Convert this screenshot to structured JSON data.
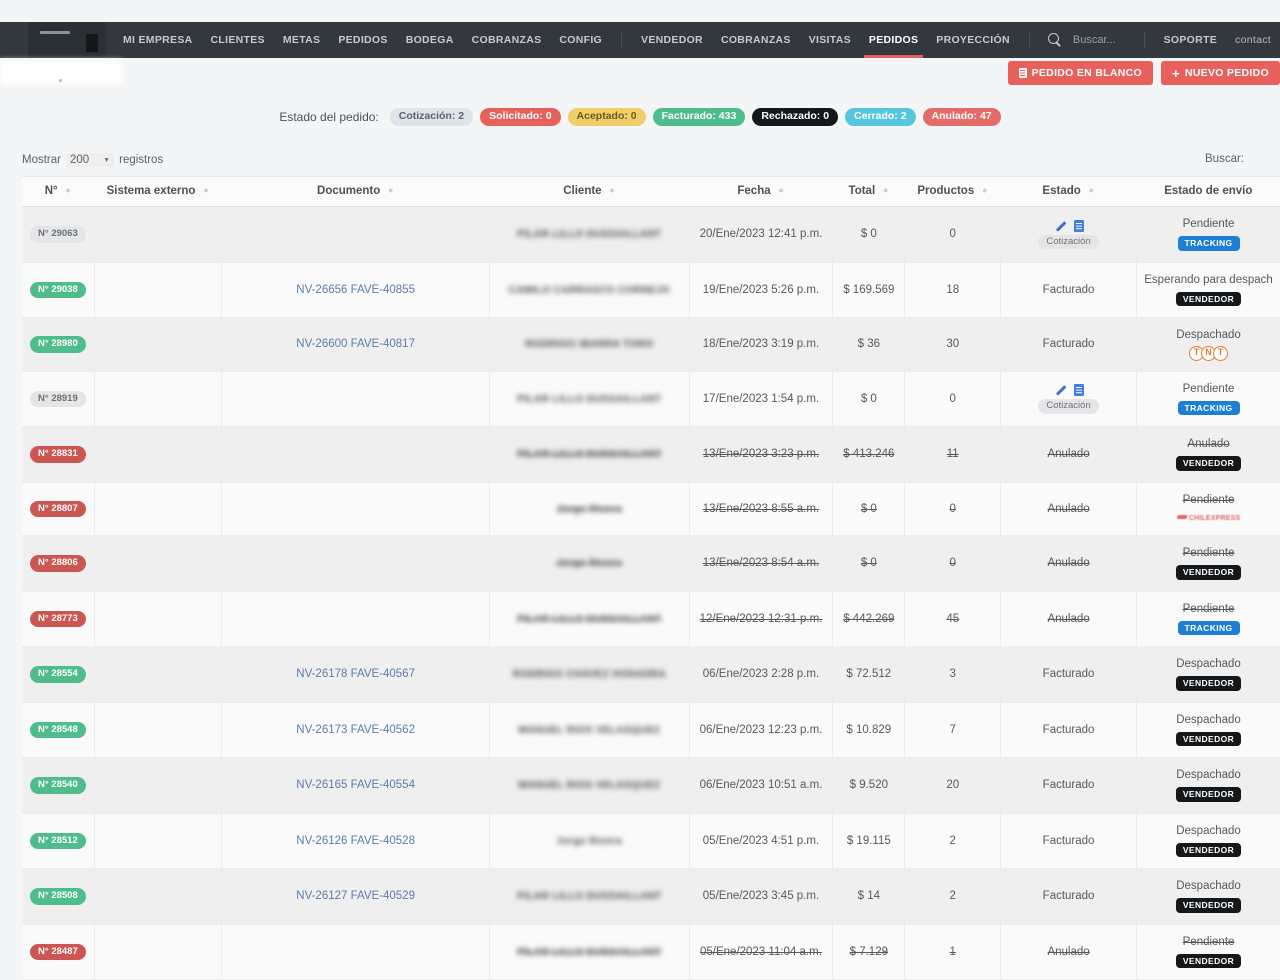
{
  "nav": {
    "primary": [
      {
        "label": "MI EMPRESA"
      },
      {
        "label": "CLIENTES"
      },
      {
        "label": "METAS"
      },
      {
        "label": "PEDIDOS"
      },
      {
        "label": "BODEGA"
      },
      {
        "label": "COBRANZAS"
      },
      {
        "label": "CONFIG"
      }
    ],
    "secondary": [
      {
        "label": "VENDEDOR",
        "active": false
      },
      {
        "label": "COBRANZAS",
        "active": false
      },
      {
        "label": "VISITAS",
        "active": false
      },
      {
        "label": "PEDIDOS",
        "active": true
      },
      {
        "label": "PROYECCIÓN",
        "active": false
      }
    ],
    "search_placeholder": "Buscar...",
    "right": [
      {
        "label": "SOPORTE"
      },
      {
        "label": "contact"
      }
    ]
  },
  "actions": {
    "blank_order": "PEDIDO EN BLANCO",
    "new_order": "NUEVO PEDIDO"
  },
  "status": {
    "label": "Estado del pedido:",
    "pills": [
      {
        "label": "Cotización: 2",
        "bg": "#dfe3ea",
        "fg": "#5b6472"
      },
      {
        "label": "Solicitado: 0",
        "bg": "#e8605c",
        "fg": "#ffffff"
      },
      {
        "label": "Aceptado: 0",
        "bg": "#f0ce6a",
        "fg": "#6d5a1c"
      },
      {
        "label": "Facturado: 433",
        "bg": "#4fbd8b",
        "fg": "#ffffff"
      },
      {
        "label": "Rechazado: 0",
        "bg": "#15181b",
        "fg": "#ffffff"
      },
      {
        "label": "Cerrado: 2",
        "bg": "#55c6de",
        "fg": "#ffffff"
      },
      {
        "label": "Anulado: 47",
        "bg": "#e46b67",
        "fg": "#ffffff"
      }
    ]
  },
  "table_controls": {
    "show_prefix": "Mostrar",
    "show_value": "200",
    "show_suffix": "registros",
    "search_label": "Buscar:"
  },
  "table": {
    "columns": [
      {
        "label": "N°",
        "sortable": true
      },
      {
        "label": "Sistema externo",
        "sortable": true
      },
      {
        "label": "Documento",
        "sortable": true
      },
      {
        "label": "Cliente",
        "sortable": true
      },
      {
        "label": "Fecha",
        "sortable": true
      },
      {
        "label": "Total",
        "sortable": true
      },
      {
        "label": "Productos",
        "sortable": true
      },
      {
        "label": "Estado",
        "sortable": true
      },
      {
        "label": "Estado de envío",
        "sortable": false
      }
    ],
    "rows": [
      {
        "num": "N° 29063",
        "num_style": "gray",
        "sistema_externo": "",
        "documento": "",
        "cliente": "PILAR LILLO DUSSAILLANT",
        "fecha": "20/Ene/2023 12:41 p.m.",
        "total": "$ 0",
        "productos": "0",
        "estado": "",
        "estado_icons": true,
        "estado_badge": "Cotización",
        "envio": "Pendiente",
        "envio_tag": "TRACKING",
        "envio_tag_type": "tracking",
        "struck": false
      },
      {
        "num": "N° 29038",
        "num_style": "green",
        "sistema_externo": "",
        "documento": "NV-26656 FAVE-40855",
        "cliente": "CAMILO CARRASCO CORNEJO",
        "fecha": "19/Ene/2023 5:26 p.m.",
        "total": "$ 169.569",
        "productos": "18",
        "estado": "Facturado",
        "estado_icons": false,
        "estado_badge": "",
        "envio": "Esperando para despach",
        "envio_tag": "VENDEDOR",
        "envio_tag_type": "vendedor",
        "struck": false
      },
      {
        "num": "N° 28980",
        "num_style": "green",
        "sistema_externo": "",
        "documento": "NV-26600 FAVE-40817",
        "cliente": "RODRIGO IBARRA TORO",
        "fecha": "18/Ene/2023 3:19 p.m.",
        "total": "$ 36",
        "productos": "30",
        "estado": "Facturado",
        "estado_icons": false,
        "estado_badge": "",
        "envio": "Despachado",
        "envio_tag": "TNT",
        "envio_tag_type": "tnt",
        "struck": false
      },
      {
        "num": "N° 28919",
        "num_style": "gray",
        "sistema_externo": "",
        "documento": "",
        "cliente": "PILAR LILLO DUSSAILLANT",
        "fecha": "17/Ene/2023 1:54 p.m.",
        "total": "$ 0",
        "productos": "0",
        "estado": "",
        "estado_icons": true,
        "estado_badge": "Cotización",
        "envio": "Pendiente",
        "envio_tag": "TRACKING",
        "envio_tag_type": "tracking",
        "struck": false
      },
      {
        "num": "N° 28831",
        "num_style": "red",
        "sistema_externo": "",
        "documento": "",
        "cliente": "PILAR LILLO DUSSAILLANT",
        "fecha": "13/Ene/2023 3:23 p.m.",
        "total": "$ 413.246",
        "productos": "11",
        "estado": "Anulado",
        "estado_icons": false,
        "estado_badge": "",
        "envio": "Anulado",
        "envio_tag": "VENDEDOR",
        "envio_tag_type": "vendedor",
        "struck": true
      },
      {
        "num": "N° 28807",
        "num_style": "red",
        "sistema_externo": "",
        "documento": "",
        "cliente": "Jorge Rivera",
        "fecha": "13/Ene/2023 8:55 a.m.",
        "total": "$ 0",
        "productos": "0",
        "estado": "Anulado",
        "estado_icons": false,
        "estado_badge": "",
        "envio": "Pendiente",
        "envio_tag": "CHILEXPRESS",
        "envio_tag_type": "chilexpress",
        "struck": true
      },
      {
        "num": "N° 28806",
        "num_style": "red",
        "sistema_externo": "",
        "documento": "",
        "cliente": "Jorge Rivera",
        "fecha": "13/Ene/2023 8:54 a.m.",
        "total": "$ 0",
        "productos": "0",
        "estado": "Anulado",
        "estado_icons": false,
        "estado_badge": "",
        "envio": "Pendiente",
        "envio_tag": "VENDEDOR",
        "envio_tag_type": "vendedor",
        "struck": true
      },
      {
        "num": "N° 28773",
        "num_style": "red",
        "sistema_externo": "",
        "documento": "",
        "cliente": "PILAR LILLO DUSSAILLANT",
        "fecha": "12/Ene/2023 12:31 p.m.",
        "total": "$ 442.269",
        "productos": "45",
        "estado": "Anulado",
        "estado_icons": false,
        "estado_badge": "",
        "envio": "Pendiente",
        "envio_tag": "TRACKING",
        "envio_tag_type": "tracking",
        "struck": true
      },
      {
        "num": "N° 28554",
        "num_style": "green",
        "sistema_externo": "",
        "documento": "NV-26178 FAVE-40567",
        "cliente": "RODRIGO CHAVEZ HONADRA",
        "fecha": "06/Ene/2023 2:28 p.m.",
        "total": "$ 72.512",
        "productos": "3",
        "estado": "Facturado",
        "estado_icons": false,
        "estado_badge": "",
        "envio": "Despachado",
        "envio_tag": "VENDEDOR",
        "envio_tag_type": "vendedor",
        "struck": false
      },
      {
        "num": "N° 28548",
        "num_style": "green",
        "sistema_externo": "",
        "documento": "NV-26173 FAVE-40562",
        "cliente": "MANUEL RIOS VELASQUEZ",
        "fecha": "06/Ene/2023 12:23 p.m.",
        "total": "$ 10.829",
        "productos": "7",
        "estado": "Facturado",
        "estado_icons": false,
        "estado_badge": "",
        "envio": "Despachado",
        "envio_tag": "VENDEDOR",
        "envio_tag_type": "vendedor",
        "struck": false
      },
      {
        "num": "N° 28540",
        "num_style": "green",
        "sistema_externo": "",
        "documento": "NV-26165 FAVE-40554",
        "cliente": "MANUEL RIOS VELASQUEZ",
        "fecha": "06/Ene/2023 10:51 a.m.",
        "total": "$ 9.520",
        "productos": "20",
        "estado": "Facturado",
        "estado_icons": false,
        "estado_badge": "",
        "envio": "Despachado",
        "envio_tag": "VENDEDOR",
        "envio_tag_type": "vendedor",
        "struck": false
      },
      {
        "num": "N° 28512",
        "num_style": "green",
        "sistema_externo": "",
        "documento": "NV-26126 FAVE-40528",
        "cliente": "Jorge Rivera",
        "fecha": "05/Ene/2023 4:51 p.m.",
        "total": "$ 19.115",
        "productos": "2",
        "estado": "Facturado",
        "estado_icons": false,
        "estado_badge": "",
        "envio": "Despachado",
        "envio_tag": "VENDEDOR",
        "envio_tag_type": "vendedor",
        "struck": false
      },
      {
        "num": "N° 28508",
        "num_style": "green",
        "sistema_externo": "",
        "documento": "NV-26127 FAVE-40529",
        "cliente": "PILAR LILLO DUSSAILLANT",
        "fecha": "05/Ene/2023 3:45 p.m.",
        "total": "$ 14",
        "productos": "2",
        "estado": "Facturado",
        "estado_icons": false,
        "estado_badge": "",
        "envio": "Despachado",
        "envio_tag": "VENDEDOR",
        "envio_tag_type": "vendedor",
        "struck": false
      },
      {
        "num": "N° 28487",
        "num_style": "red",
        "sistema_externo": "",
        "documento": "",
        "cliente": "PILAR LILLO DUSSAILLANT",
        "fecha": "05/Ene/2023 11:04 a.m.",
        "total": "$ 7.129",
        "productos": "1",
        "estado": "Anulado",
        "estado_icons": false,
        "estado_badge": "",
        "envio": "Pendiente",
        "envio_tag": "VENDEDOR",
        "envio_tag_type": "vendedor",
        "struck": true
      }
    ]
  },
  "colors": {
    "navbar": "#33383e",
    "accent_red": "#e8605c",
    "green": "#4fbd8b",
    "red_badge": "#cc5652",
    "tracking_blue": "#1d7fd4",
    "tnt_orange": "#e8762e"
  }
}
